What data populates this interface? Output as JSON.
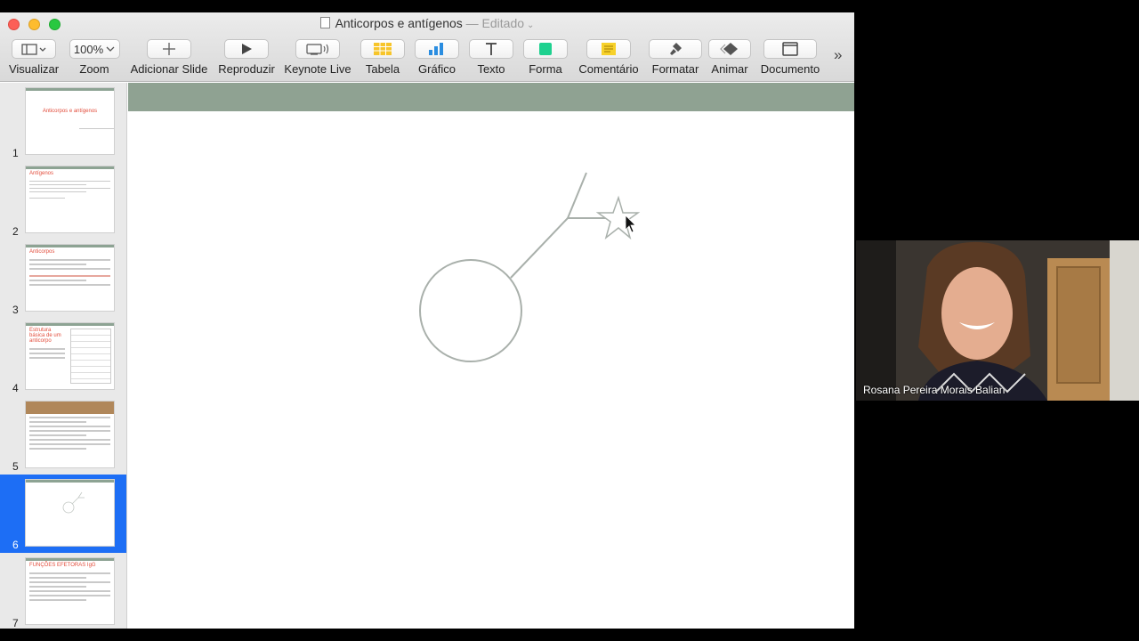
{
  "window": {
    "title": "Anticorpos e antígenos",
    "status": "— Editado"
  },
  "toolbar": {
    "zoom_value": "100%",
    "items": [
      {
        "label": "Visualizar",
        "icon": "sidebar-view-icon"
      },
      {
        "label": "Zoom",
        "icon": "zoom-dropdown"
      },
      {
        "label": "Adicionar Slide",
        "icon": "plus-icon"
      },
      {
        "label": "Reproduzir",
        "icon": "play-icon"
      },
      {
        "label": "Keynote Live",
        "icon": "keynote-live-icon"
      },
      {
        "label": "Tabela",
        "icon": "table-icon"
      },
      {
        "label": "Gráfico",
        "icon": "chart-icon"
      },
      {
        "label": "Texto",
        "icon": "text-icon"
      },
      {
        "label": "Forma",
        "icon": "shape-icon"
      },
      {
        "label": "Comentário",
        "icon": "comment-icon"
      },
      {
        "label": "Formatar",
        "icon": "format-brush-icon"
      },
      {
        "label": "Animar",
        "icon": "animate-icon"
      },
      {
        "label": "Documento",
        "icon": "document-icon"
      }
    ],
    "overflow": "»"
  },
  "slides": [
    {
      "number": "1",
      "title": "Anticorpos e antígenos"
    },
    {
      "number": "2",
      "title": "Antígenos"
    },
    {
      "number": "3",
      "title": "Anticorpos"
    },
    {
      "number": "4",
      "title": "Estrutura básica de um anticorpo"
    },
    {
      "number": "5",
      "title": ""
    },
    {
      "number": "6",
      "title": ""
    },
    {
      "number": "7",
      "title": "FUNÇÕES EFETORAS IgG"
    }
  ],
  "selected_slide": "6",
  "colors": {
    "accent_blue": "#1d6ef5",
    "slide_band": "#8fa292",
    "drawing_stroke": "#a9b0ab",
    "title_red": "#e24c3b"
  },
  "video": {
    "participant_name": "Rosana Pereira Morais Balian"
  }
}
